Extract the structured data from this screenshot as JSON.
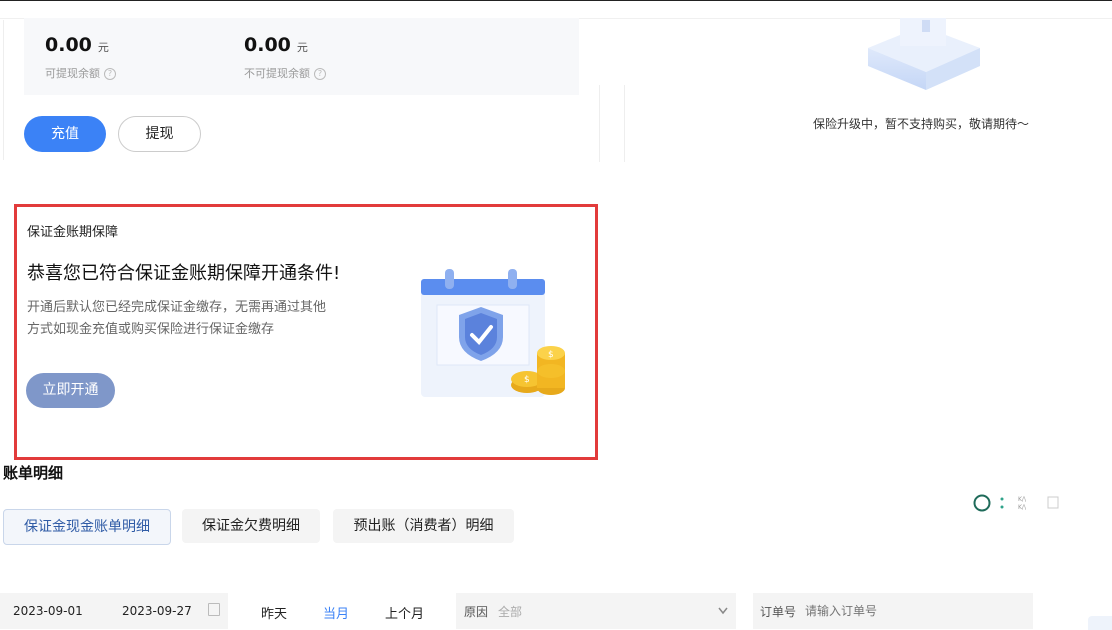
{
  "balance": {
    "withdrawable_amount": "0.00",
    "withdrawable_unit": "元",
    "withdrawable_label": "可提现余额",
    "non_withdrawable_amount": "0.00",
    "non_withdrawable_unit": "元",
    "non_withdrawable_label": "不可提现余额"
  },
  "actions": {
    "recharge_label": "充值",
    "withdraw_label": "提现"
  },
  "insurance": {
    "notice": "保险升级中，暂不支持购买，敬请期待～"
  },
  "guarantee": {
    "section_title": "保证金账期保障",
    "heading": "恭喜您已符合保证金账期保障开通条件!",
    "desc_line1": "开通后默认您已经完成保证金缴存，无需再通过其他",
    "desc_line2": "方式如现金充值或购买保险进行保证金缴存",
    "button_label": "立即开通"
  },
  "bill": {
    "title": "账单明细",
    "tabs": [
      {
        "label": "保证金现金账单明细",
        "active": true
      },
      {
        "label": "保证金欠费明细",
        "active": false
      },
      {
        "label": "预出账（消费者）明细",
        "active": false
      }
    ]
  },
  "filters": {
    "start_date": "2023-09-01",
    "end_date": "2023-09-27",
    "quick_yesterday": "昨天",
    "quick_this_month": "当月",
    "quick_last_month": "上个月",
    "reason_label": "原因",
    "reason_value": "全部",
    "order_label": "订单号",
    "order_placeholder": "请输入订单号"
  },
  "colors": {
    "primary": "#3b82f6",
    "highlight_border": "#e23b3b",
    "tab_active_text": "#2f5ba6",
    "open_button": "#7f97c9"
  }
}
